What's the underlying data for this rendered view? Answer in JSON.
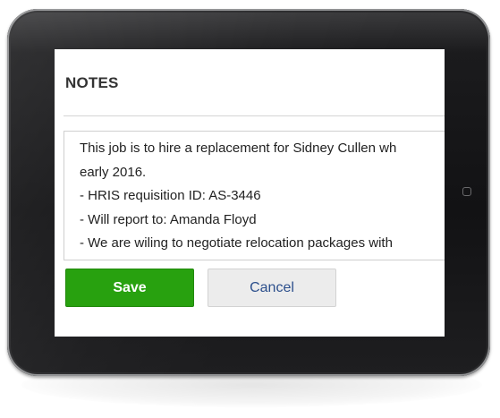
{
  "notes": {
    "title": "NOTES",
    "lines": [
      "This job is to hire a replacement for Sidney Cullen wh",
      "early 2016.",
      "- HRIS requisition ID: AS-3446",
      "- Will report to: Amanda Floyd",
      "- We are wiling to negotiate relocation packages with"
    ]
  },
  "actions": {
    "save_label": "Save",
    "cancel_label": "Cancel"
  },
  "colors": {
    "save_button": "#28a10f",
    "cancel_button": "#ececec",
    "cancel_text": "#2c4f8c",
    "device_frame": "#121214"
  }
}
